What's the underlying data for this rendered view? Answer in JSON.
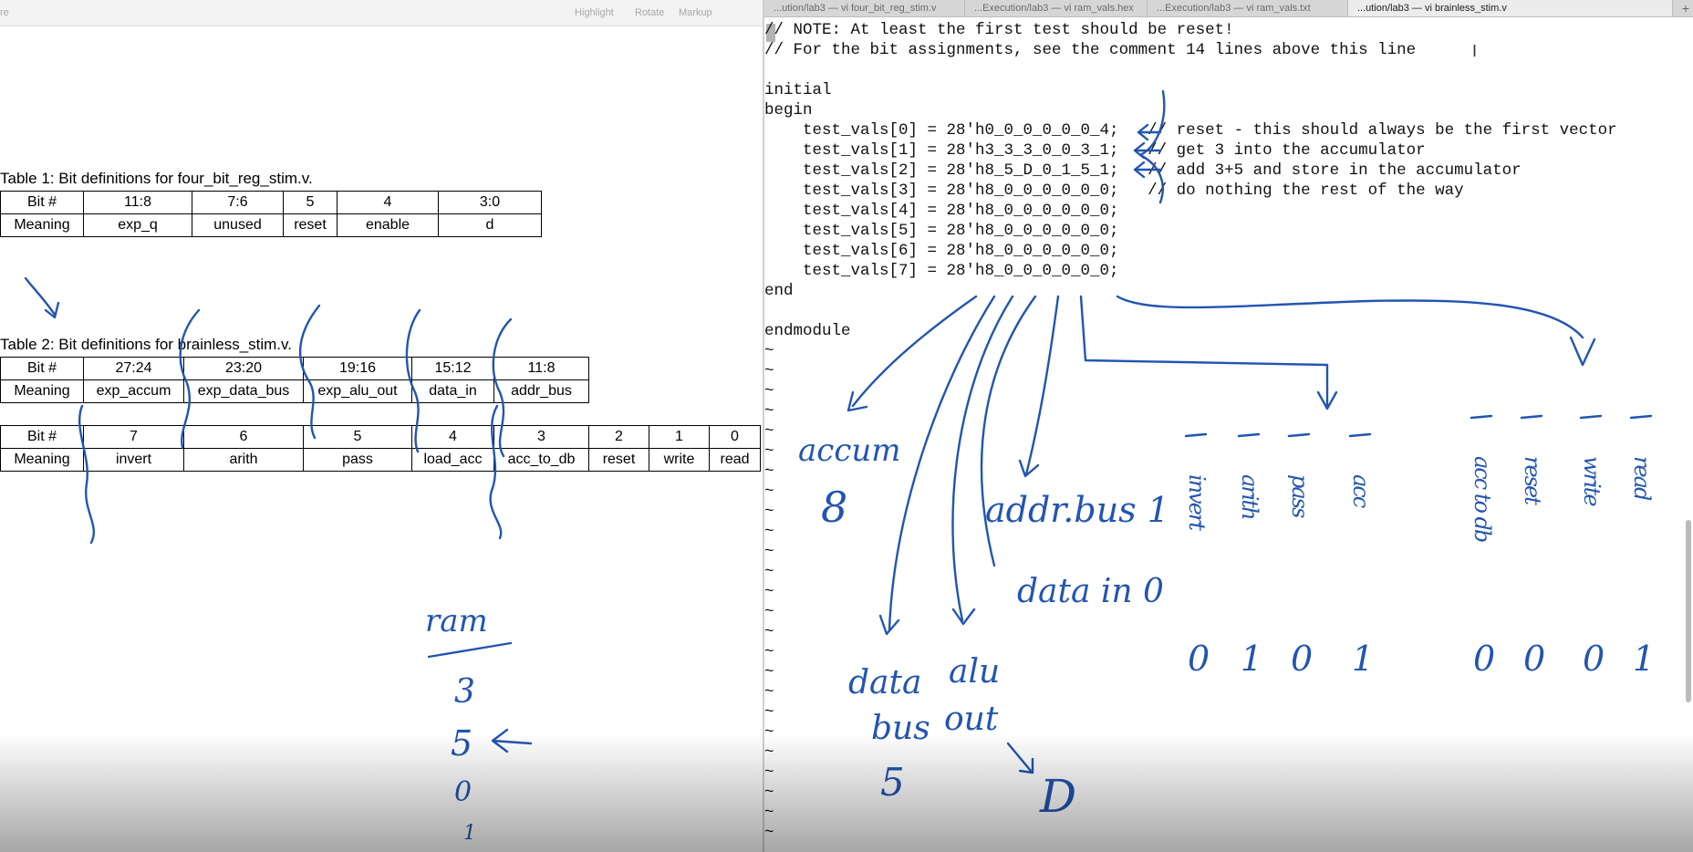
{
  "pdf": {
    "toolbar": {
      "cut_label": "re",
      "highlight": "Highlight",
      "rotate": "Rotate",
      "markup": "Markup"
    },
    "table1": {
      "caption": "Table 1: Bit definitions for four_bit_reg_stim.v.",
      "rows": [
        [
          "Bit #",
          "11:8",
          "7:6",
          "5",
          "4",
          "3:0"
        ],
        [
          "Meaning",
          "exp_q",
          "unused",
          "reset",
          "enable",
          "d"
        ]
      ]
    },
    "table2": {
      "caption": "Table 2: Bit definitions for brainless_stim.v.",
      "rows": [
        [
          "Bit #",
          "27:24",
          "23:20",
          "19:16",
          "15:12",
          "11:8"
        ],
        [
          "Meaning",
          "exp_accum",
          "exp_data_bus",
          "exp_alu_out",
          "data_in",
          "addr_bus"
        ]
      ]
    },
    "table3": {
      "rows": [
        [
          "Bit #",
          "7",
          "6",
          "5",
          "4",
          "3",
          "2",
          "1",
          "0"
        ],
        [
          "Meaning",
          "invert",
          "arith",
          "pass",
          "load_acc",
          "acc_to_db",
          "reset",
          "write",
          "read"
        ]
      ]
    }
  },
  "terminal": {
    "tabs": [
      "...ution/lab3 — vi four_bit_reg_stim.v",
      "...Execution/lab3 — vi ram_vals.hex",
      "...Execution/lab3 — vi ram_vals.txt",
      "...ution/lab3 — vi brainless_stim.v"
    ],
    "plus": "+",
    "code": "// NOTE: At least the first test should be reset!\n// For the bit assignments, see the comment 14 lines above this line\n\ninitial\nbegin\n    test_vals[0] = 28'h0_0_0_0_0_0_4;   // reset - this should always be the first vector\n    test_vals[1] = 28'h3_3_3_0_0_3_1;   // get 3 into the accumulator\n    test_vals[2] = 28'h8_5_D_0_1_5_1;   // add 3+5 and store in the accumulator\n    test_vals[3] = 28'h8_0_0_0_0_0_0;   // do nothing the rest of the way\n    test_vals[4] = 28'h8_0_0_0_0_0_0;\n    test_vals[5] = 28'h8_0_0_0_0_0_0;\n    test_vals[6] = 28'h8_0_0_0_0_0_0;\n    test_vals[7] = 28'h8_0_0_0_0_0_0;\nend\n\nendmodule",
    "tildes": "~\n~\n~\n~\n~\n~\n~\n~\n~\n~\n~\n~\n~\n~\n~\n~\n~\n~\n~\n~\n~\n~\n~\n~\n~"
  },
  "annotations": {
    "accum": "accum",
    "eight": "8",
    "addr_bus": "addr.bus 1",
    "data_in": "data in 0",
    "data_bus": [
      "data",
      "bus"
    ],
    "alu_out": [
      "alu",
      "out"
    ],
    "five": "5",
    "d_val": "D",
    "ram": "ram",
    "ram_vals": [
      "3",
      "5",
      "0",
      "1"
    ],
    "bit_words": [
      "invert",
      "arith",
      "pass",
      "acc",
      "acc to db",
      "reset",
      "write",
      "read"
    ],
    "bit_values": [
      "0",
      "1",
      "0",
      "1",
      "0",
      "0",
      "0",
      "1"
    ]
  }
}
